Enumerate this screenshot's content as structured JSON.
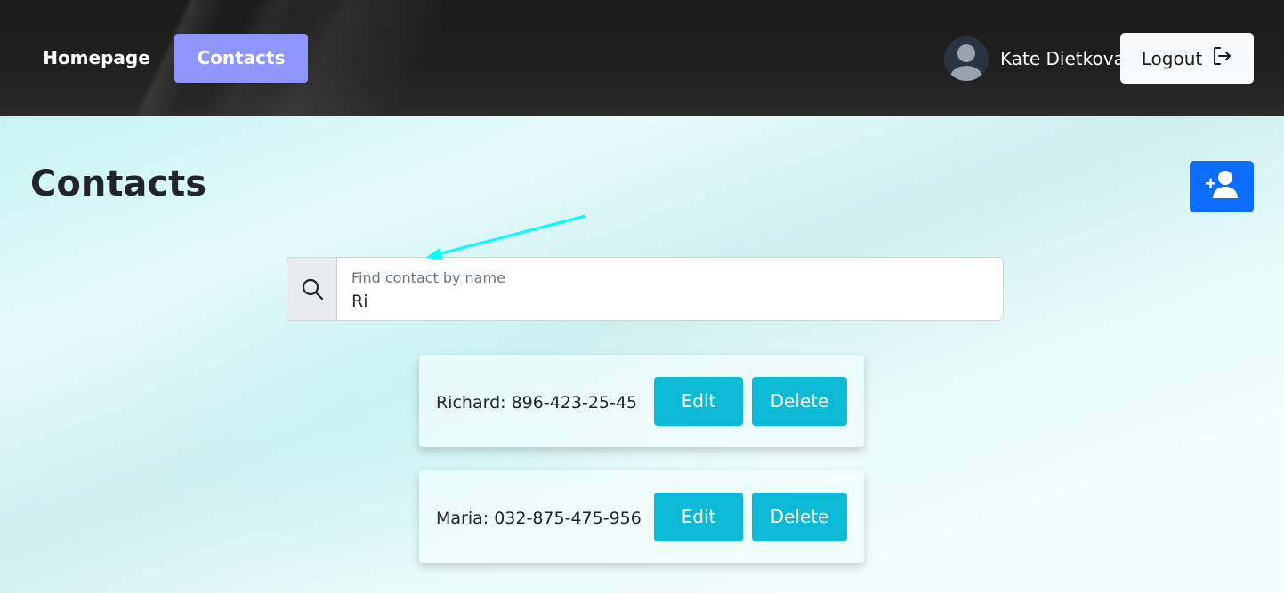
{
  "header": {
    "nav": {
      "homepage_label": "Homepage",
      "contacts_label": "Contacts"
    },
    "user": {
      "name": "Kate Dietkova",
      "avatar_icon": "user-avatar-icon"
    },
    "logout": {
      "label": "Logout",
      "icon": "logout-icon"
    }
  },
  "page": {
    "title": "Contacts",
    "add_contact_icon": "add-user-icon"
  },
  "search": {
    "icon": "search-icon",
    "label": "Find contact by name",
    "value": "Ri"
  },
  "contacts": [
    {
      "text": "Richard: 896-423-25-45",
      "edit_label": "Edit",
      "delete_label": "Delete"
    },
    {
      "text": "Maria: 032-875-475-956",
      "edit_label": "Edit",
      "delete_label": "Delete"
    }
  ],
  "colors": {
    "nav_active": "#8f95ff",
    "primary": "#0d6efd",
    "info": "#0dbad6",
    "annotation_arrow": "#00ffff"
  }
}
